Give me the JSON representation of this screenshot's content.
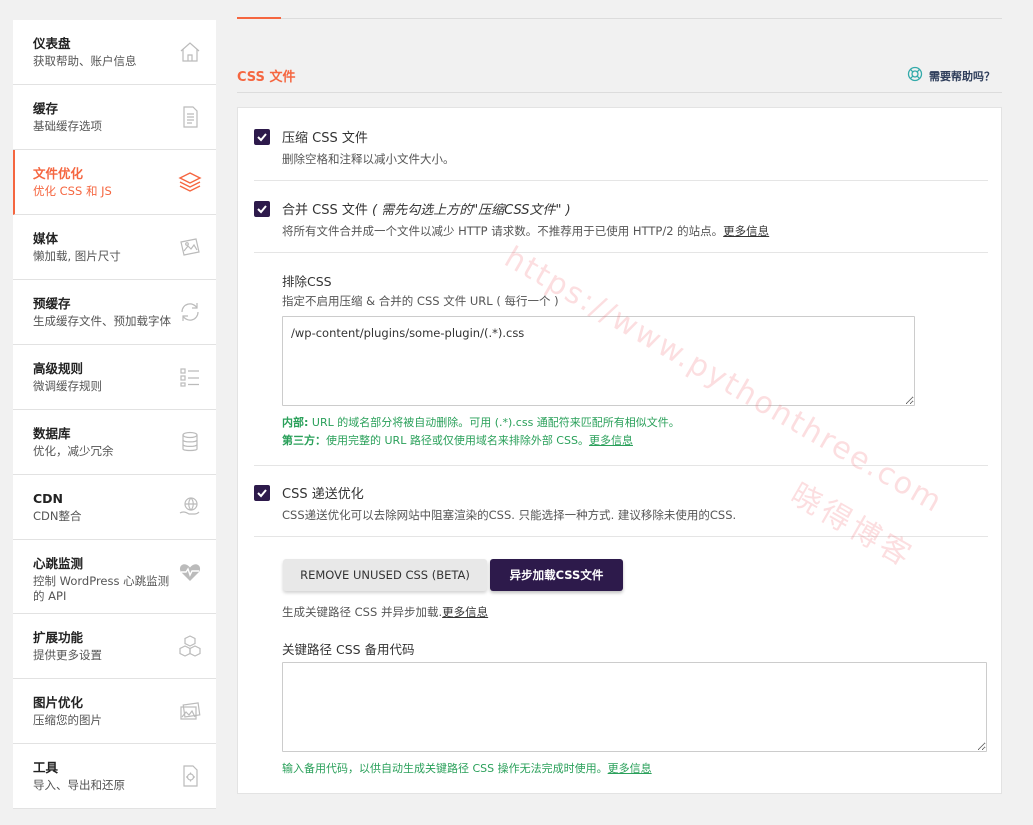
{
  "sidebar": {
    "items": [
      {
        "title": "仪表盘",
        "sub": "获取帮助、账户信息",
        "icon": "home-icon"
      },
      {
        "title": "缓存",
        "sub": "基础缓存选项",
        "icon": "file-icon"
      },
      {
        "title": "文件优化",
        "sub": "优化 CSS 和 JS",
        "icon": "layers-icon"
      },
      {
        "title": "媒体",
        "sub": "懒加载, 图片尺寸",
        "icon": "image-icon"
      },
      {
        "title": "预缓存",
        "sub": "生成缓存文件、预加载字体",
        "icon": "refresh-icon"
      },
      {
        "title": "高级规则",
        "sub": "微调缓存规则",
        "icon": "list-icon"
      },
      {
        "title": "数据库",
        "sub": "优化，减少冗余",
        "icon": "database-icon"
      },
      {
        "title": "CDN",
        "sub": "CDN整合",
        "icon": "globe-hand-icon"
      },
      {
        "title": "心跳监测",
        "sub": "控制 WordPress 心跳监测的 API",
        "icon": "heart-pulse-icon"
      },
      {
        "title": "扩展功能",
        "sub": "提供更多设置",
        "icon": "cubes-icon"
      },
      {
        "title": "图片优化",
        "sub": "压缩您的图片",
        "icon": "images-icon"
      },
      {
        "title": "工具",
        "sub": "导入、导出和还原",
        "icon": "file-gear-icon"
      }
    ]
  },
  "section": {
    "title": "CSS 文件",
    "help": "需要帮助吗？"
  },
  "options": {
    "minify": {
      "title": "压缩 CSS 文件",
      "desc": "删除空格和注释以减小文件大小。",
      "checked": true
    },
    "combine": {
      "title": "合并 CSS 文件",
      "hint": "( 需先勾选上方的\"压缩CSS文件\" )",
      "desc": "将所有文件合并成一个文件以减少 HTTP 请求数。不推荐用于已使用 HTTP/2 的站点。",
      "link": "更多信息",
      "checked": true
    },
    "exclude": {
      "label": "排除CSS",
      "desc": "指定不启用压缩 & 合并的 CSS 文件 URL ( 每行一个 )",
      "value": "/wp-content/plugins/some-plugin/(.*).css",
      "note1_bold": "内部:",
      "note1": " URL 的域名部分将被自动删除。可用 (.*).css 通配符来匹配所有相似文件。",
      "note2_bold": "第三方：",
      "note2": "使用完整的 URL 路径或仅使用域名来排除外部 CSS。",
      "note2_link": "更多信息"
    },
    "delivery": {
      "title": "CSS 递送优化",
      "desc": "CSS递送优化可以去除网站中阻塞渲染的CSS. 只能选择一种方式. 建议移除未使用的CSS.",
      "checked": true
    },
    "buttons": {
      "remove_unused": "REMOVE UNUSED CSS (BETA)",
      "async": "异步加载CSS文件"
    },
    "critical": {
      "desc": "生成关键路径 CSS 并异步加载.",
      "link": "更多信息",
      "label": "关键路径 CSS 备用代码",
      "value": "",
      "note": "输入备用代码，以供自动生成关键路径 CSS 操作无法完成时使用。",
      "note_link": "更多信息"
    }
  },
  "watermark": {
    "line1": "https://www.pythonthree.com",
    "line2": "晓得博客"
  },
  "colors": {
    "accent": "#f56640",
    "checkbox": "#2d1a4b",
    "green": "#2aa05a"
  }
}
